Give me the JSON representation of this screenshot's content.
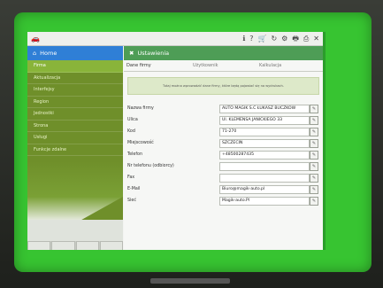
{
  "app": {
    "topbar_icons": [
      "car-icon",
      "info-icon",
      "help-icon",
      "cart-icon",
      "refresh-icon",
      "settings-icon",
      "print-icon",
      "printer-icon",
      "tools-icon"
    ]
  },
  "sidebar": {
    "home_label": "Home",
    "items": [
      {
        "label": "Firma",
        "active": true
      },
      {
        "label": "Aktualizacja",
        "active": false
      },
      {
        "label": "Interfejsy",
        "active": false
      },
      {
        "label": "Region",
        "active": false
      },
      {
        "label": "Jednostki",
        "active": false
      },
      {
        "label": "Strona",
        "active": false
      },
      {
        "label": "Usługi",
        "active": false
      },
      {
        "label": "Funkcje zdalne",
        "active": false
      }
    ]
  },
  "main": {
    "title": "Ustawienia",
    "tabs": [
      {
        "label": "Dane firmy",
        "active": true
      },
      {
        "label": "Użytkownik",
        "active": false
      },
      {
        "label": "Kalkulacja",
        "active": false
      }
    ],
    "info_text": "Tutaj można wprowadzić dane firmy, które będą pojawiać się na wydrukach.",
    "fields": [
      {
        "label": "Nazwa firmy",
        "value": "AUTO MAGIK S.C ŁUKASZ BUCZKOW"
      },
      {
        "label": "Ulica",
        "value": "Ul. KLEMENSA JANICKIEGO 33"
      },
      {
        "label": "Kod",
        "value": "71-270"
      },
      {
        "label": "Miejscowość",
        "value": "SZCZECIN"
      },
      {
        "label": "Telefon",
        "value": "+48500287435"
      },
      {
        "label": "Nr telefonu (odbiorcy)",
        "value": ""
      },
      {
        "label": "Fax",
        "value": ""
      },
      {
        "label": "E-Mail",
        "value": "Biuro@magik-auto.pl"
      },
      {
        "label": "Sieć",
        "value": "Magik-auto.Pl"
      }
    ]
  }
}
